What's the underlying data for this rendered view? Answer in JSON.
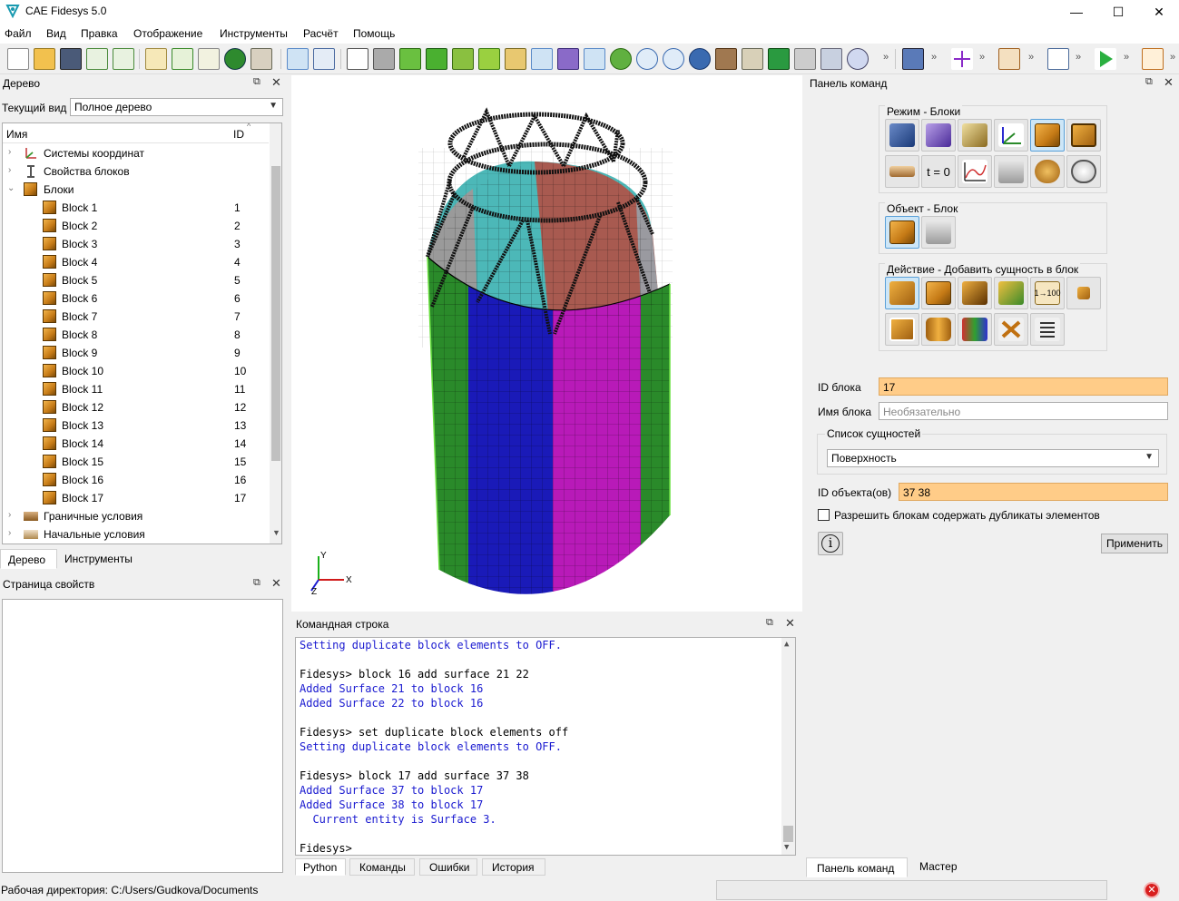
{
  "window": {
    "title": "CAE Fidesys 5.0",
    "min_glyph": "—",
    "max_glyph": "☐",
    "close_glyph": "✕"
  },
  "menu": [
    "Файл",
    "Вид",
    "Правка",
    "Отображение",
    "Инструменты",
    "Расчёт",
    "Помощь"
  ],
  "toolbar": {
    "overflow_glyph": "»"
  },
  "tree_panel": {
    "title": "Дерево",
    "view_label": "Текущий вид",
    "view_value": "Полное дерево",
    "col_name": "Имя",
    "col_id": "ID",
    "coord_systems": "Системы координат",
    "block_props": "Свойства блоков",
    "blocks": "Блоки",
    "block_items": [
      {
        "name": "Block 1",
        "id": "1"
      },
      {
        "name": "Block 2",
        "id": "2"
      },
      {
        "name": "Block 3",
        "id": "3"
      },
      {
        "name": "Block 4",
        "id": "4"
      },
      {
        "name": "Block 5",
        "id": "5"
      },
      {
        "name": "Block 6",
        "id": "6"
      },
      {
        "name": "Block 7",
        "id": "7"
      },
      {
        "name": "Block 8",
        "id": "8"
      },
      {
        "name": "Block 9",
        "id": "9"
      },
      {
        "name": "Block 10",
        "id": "10"
      },
      {
        "name": "Block 11",
        "id": "11"
      },
      {
        "name": "Block 12",
        "id": "12"
      },
      {
        "name": "Block 13",
        "id": "13"
      },
      {
        "name": "Block 14",
        "id": "14"
      },
      {
        "name": "Block 15",
        "id": "15"
      },
      {
        "name": "Block 16",
        "id": "16"
      },
      {
        "name": "Block 17",
        "id": "17"
      }
    ],
    "boundary": "Граничные условия",
    "initial": "Начальные условия",
    "tabs": [
      "Дерево",
      "Инструменты"
    ]
  },
  "props_panel": {
    "title": "Страница свойств"
  },
  "axes": {
    "x": "X",
    "y": "Y",
    "z": "Z"
  },
  "cmd_panel": {
    "title": "Командная строка",
    "lines": [
      {
        "t": "Setting duplicate block elements to OFF.",
        "c": "blue"
      },
      {
        "t": "",
        "c": ""
      },
      {
        "t": "Fidesys> block 16 add surface 21 22",
        "c": ""
      },
      {
        "t": "Added Surface 21 to block 16",
        "c": "blue"
      },
      {
        "t": "Added Surface 22 to block 16",
        "c": "blue"
      },
      {
        "t": "",
        "c": ""
      },
      {
        "t": "Fidesys> set duplicate block elements off",
        "c": ""
      },
      {
        "t": "Setting duplicate block elements to OFF.",
        "c": "blue"
      },
      {
        "t": "",
        "c": ""
      },
      {
        "t": "Fidesys> block 17 add surface 37 38",
        "c": ""
      },
      {
        "t": "Added Surface 37 to block 17",
        "c": "blue"
      },
      {
        "t": "Added Surface 38 to block 17",
        "c": "blue"
      },
      {
        "t": "  Current entity is Surface 3.",
        "c": "blue"
      },
      {
        "t": "",
        "c": ""
      },
      {
        "t": "Fidesys>",
        "c": ""
      }
    ],
    "tabs": [
      "Python",
      "Команды",
      "Ошибки",
      "История"
    ]
  },
  "cmd_panel_right": {
    "title": "Панель команд",
    "mode_group": "Режим - Блоки",
    "object_group": "Объект - Блок",
    "action_group": "Действие - Добавить сущность в блок",
    "t0_label": "t = 0",
    "range_label": "1→100",
    "block_id_label": "ID блока",
    "block_id_value": "17",
    "block_name_label": "Имя блока",
    "block_name_placeholder": "Необязательно",
    "entity_list_label": "Список сущностей",
    "entity_type": "Поверхность",
    "object_ids_label": "ID объекта(ов)",
    "object_ids_value": "37 38",
    "allow_dup_label": "Разрешить блокам содержать дубликаты элементов",
    "apply_label": "Применить",
    "info_glyph": "i",
    "tabs": [
      "Панель команд",
      "Мастер"
    ]
  },
  "status": {
    "workdir": "Рабочая директория: C:/Users/Gudkova/Documents"
  }
}
